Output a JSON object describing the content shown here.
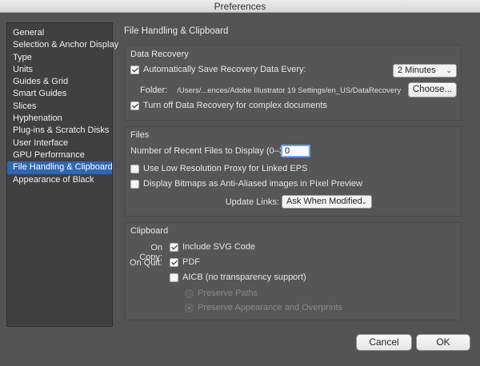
{
  "window": {
    "title": "Preferences"
  },
  "sidebar": {
    "items": [
      {
        "label": "General"
      },
      {
        "label": "Selection & Anchor Display"
      },
      {
        "label": "Type"
      },
      {
        "label": "Units"
      },
      {
        "label": "Guides & Grid"
      },
      {
        "label": "Smart Guides"
      },
      {
        "label": "Slices"
      },
      {
        "label": "Hyphenation"
      },
      {
        "label": "Plug-ins & Scratch Disks"
      },
      {
        "label": "User Interface"
      },
      {
        "label": "GPU Performance"
      },
      {
        "label": "File Handling & Clipboard",
        "selected": true
      },
      {
        "label": "Appearance of Black"
      }
    ]
  },
  "page": {
    "title": "File Handling & Clipboard"
  },
  "recovery": {
    "title": "Data Recovery",
    "auto_save_label": "Automatically Save Recovery Data Every:",
    "auto_save_checked": true,
    "interval_value": "2 Minutes",
    "folder_label": "Folder:",
    "folder_path": "/Users/...ences/Adobe Illustrator 19 Settings/en_US/DataRecovery",
    "choose_label": "Choose...",
    "turn_off_label": "Turn off Data Recovery for complex documents",
    "turn_off_checked": true
  },
  "files": {
    "title": "Files",
    "recent_label": "Number of Recent Files to Display (0–30):",
    "recent_value": "0",
    "low_res_label": "Use Low Resolution Proxy for Linked EPS",
    "low_res_checked": false,
    "bitmaps_label": "Display Bitmaps as Anti-Aliased images in Pixel Preview",
    "bitmaps_checked": false,
    "update_links_label": "Update Links:",
    "update_links_value": "Ask When Modified"
  },
  "clipboard": {
    "title": "Clipboard",
    "on_copy_label": "On Copy:",
    "include_svg_label": "Include SVG Code",
    "include_svg_checked": true,
    "on_quit_label": "On Quit:",
    "pdf_label": "PDF",
    "pdf_checked": true,
    "aicb_label": "AICB (no transparency support)",
    "aicb_checked": false,
    "preserve_paths_label": "Preserve Paths",
    "preserve_appearance_label": "Preserve Appearance and Overprints"
  },
  "footer": {
    "cancel_label": "Cancel",
    "ok_label": "OK"
  },
  "icons": {
    "dropdown": "chevron-down-icon"
  },
  "colors": {
    "selection": "#2f66b5",
    "focus_ring": "#6ea2e8"
  }
}
